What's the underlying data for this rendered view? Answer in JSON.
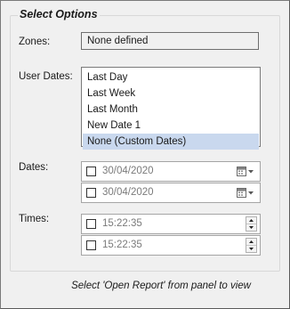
{
  "panel": {
    "title": "Select Options",
    "footer_note": "Select 'Open Report' from panel to view"
  },
  "zones": {
    "label": "Zones:",
    "value": "None defined"
  },
  "user_dates": {
    "label": "User Dates:",
    "items": [
      "Last Day",
      "Last Week",
      "Last Month",
      "New Date 1",
      "None (Custom Dates)"
    ],
    "selected": "None (Custom Dates)"
  },
  "dates": {
    "label": "Dates:",
    "from": "30/04/2020",
    "to": "30/04/2020"
  },
  "times": {
    "label": "Times:",
    "from": "15:22:35",
    "to": "15:22:35"
  }
}
